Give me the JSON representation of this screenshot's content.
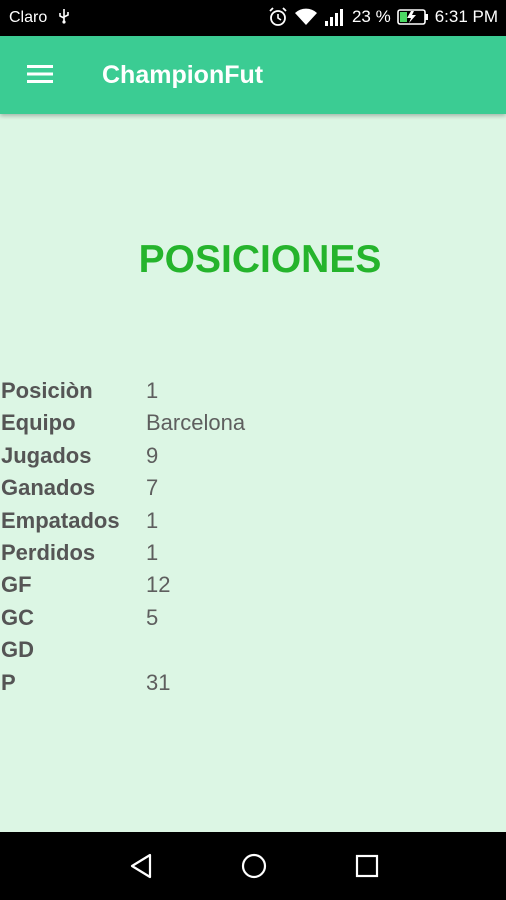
{
  "status_bar": {
    "carrier": "Claro",
    "battery": "23 %",
    "time": "6:31 PM",
    "icons": [
      "usb-icon",
      "alarm-icon",
      "wifi-icon",
      "signal-icon",
      "battery-icon"
    ]
  },
  "app_bar": {
    "title": "ChampionFut",
    "menu_icon": "hamburger-menu-icon",
    "color": "#3bcc93"
  },
  "page": {
    "heading": "POSICIONES",
    "heading_color": "#25b42c",
    "background": "#dcf6e4"
  },
  "stats": [
    {
      "label": "Posiciòn",
      "value": "1"
    },
    {
      "label": "Equipo",
      "value": "Barcelona"
    },
    {
      "label": "Jugados",
      "value": "9"
    },
    {
      "label": "Ganados",
      "value": "7"
    },
    {
      "label": "Empatados",
      "value": "1"
    },
    {
      "label": "Perdidos",
      "value": "1"
    },
    {
      "label": "GF",
      "value": "12"
    },
    {
      "label": "GC",
      "value": "5"
    },
    {
      "label": "GD",
      "value": ""
    },
    {
      "label": "P",
      "value": "31"
    }
  ],
  "nav_bar": {
    "icons": [
      "back-icon",
      "home-icon",
      "recents-icon"
    ]
  }
}
